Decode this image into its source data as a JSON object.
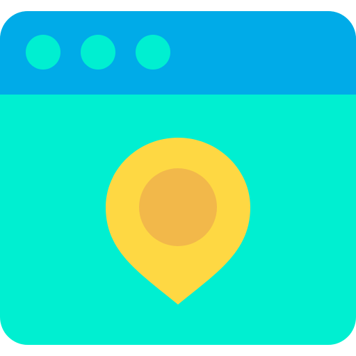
{
  "window": {
    "colors": {
      "titlebar": "#00ABE8",
      "body": "#00EFD1",
      "dots": "#00EFD1",
      "pin": "#FED843",
      "pin_center": "#F2B84A"
    },
    "titlebar": {
      "controls": [
        {
          "name": "window-dot-1",
          "icon": "circle"
        },
        {
          "name": "window-dot-2",
          "icon": "circle"
        },
        {
          "name": "window-dot-3",
          "icon": "circle"
        }
      ]
    },
    "content": {
      "icon": "location-pin-icon"
    }
  }
}
